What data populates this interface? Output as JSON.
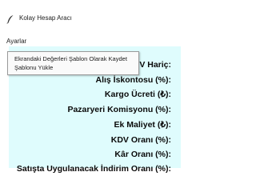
{
  "window": {
    "title": "Kolay Hesap Aracı"
  },
  "menubar": {
    "menu_label": "Ayarlar"
  },
  "dropdown": {
    "items": [
      "Ekrandaki Değerleri Şablon Olarak Kaydet",
      "Şablonu Yükle"
    ]
  },
  "form": {
    "labels": [
      "V Hariç:",
      "Alış İskontosu (%):",
      "Kargo Ücreti (₺):",
      "Pazaryeri Komisyonu (%):",
      "Ek Maliyet (₺):",
      "KDV Oranı (%):",
      "Kâr Oranı (%):",
      "Satışta Uygulanacak İndirim Oranı (%):"
    ]
  }
}
